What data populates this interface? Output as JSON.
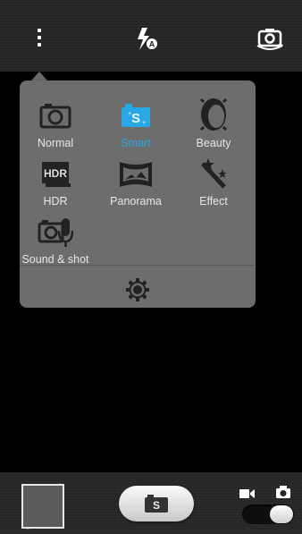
{
  "topbar": {
    "icons": [
      "more-options-icon",
      "flash-auto-icon",
      "switch-camera-icon"
    ]
  },
  "modes": [
    {
      "label": "Normal",
      "icon": "camera-icon",
      "selected": false
    },
    {
      "label": "Smart",
      "icon": "smart-camera-icon",
      "selected": true
    },
    {
      "label": "Beauty",
      "icon": "beauty-face-icon",
      "selected": false
    },
    {
      "label": "HDR",
      "icon": "hdr-icon",
      "selected": false
    },
    {
      "label": "Panorama",
      "icon": "panorama-icon",
      "selected": false
    },
    {
      "label": "Effect",
      "icon": "magic-wand-icon",
      "selected": false
    },
    {
      "label": "Sound & shot",
      "icon": "sound-shot-icon",
      "selected": false
    }
  ],
  "colors": {
    "selected": "#2aa8e6",
    "menu_bg": "#6d6d6d",
    "bar_bg": "#242424"
  },
  "bottombar": {
    "shutter_icon": "smart-camera-icon",
    "toggle_state": "photo"
  }
}
